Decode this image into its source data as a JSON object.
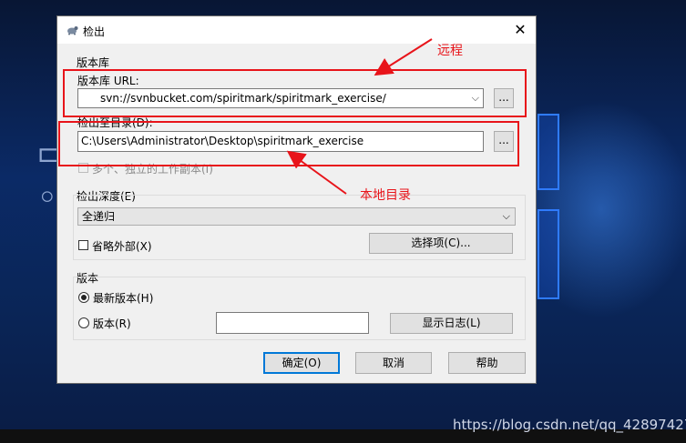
{
  "dialog": {
    "title": "检出",
    "close_glyph": "✕"
  },
  "repo": {
    "group_label": "版本库",
    "url_label": "版本库 URL:",
    "url_value": "svn://svnbucket.com/spiritmark/spiritmark_exercise/",
    "browse_label": "..."
  },
  "checkout": {
    "dir_label": "检出至目录(D):",
    "dir_value": "C:\\Users\\Administrator\\Desktop\\spiritmark_exercise",
    "browse_label": "...",
    "multi_label": "多个、独立的工作副本(I)"
  },
  "depth": {
    "group_label": "检出深度(E)",
    "selected": "全递归",
    "omit_externals_label": "省略外部(X)",
    "choose_items_label": "选择项(C)..."
  },
  "revision": {
    "group_label": "版本",
    "head_label": "最新版本(H)",
    "rev_label": "版本(R)",
    "rev_value": "",
    "show_log_label": "显示日志(L)"
  },
  "buttons": {
    "ok": "确定(O)",
    "cancel": "取消",
    "help": "帮助"
  },
  "annotations": {
    "remote": "远程",
    "local_dir": "本地目录"
  },
  "watermark": "https://blog.csdn.net/qq_42897427",
  "colors": {
    "annotation": "#e8141a",
    "default_button_border": "#0078d7"
  }
}
